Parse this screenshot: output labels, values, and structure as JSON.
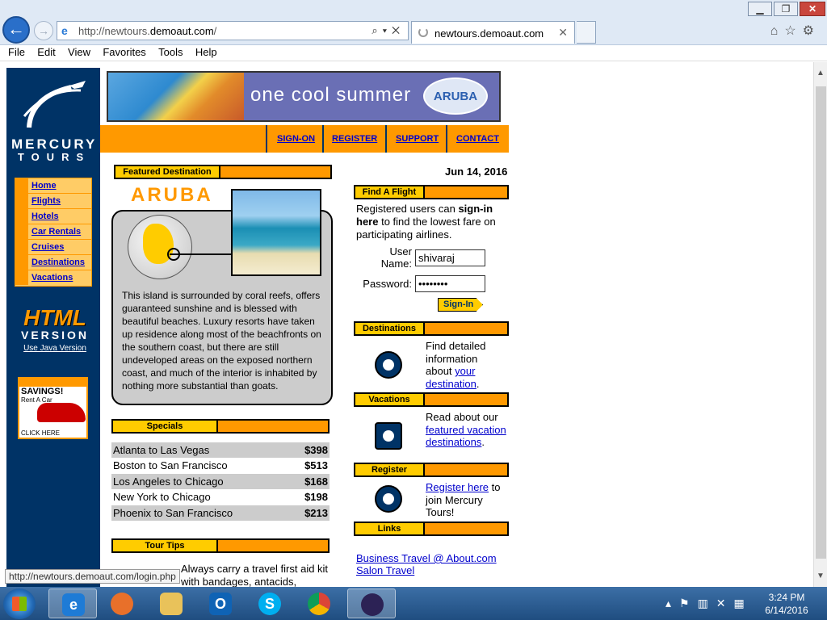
{
  "browser": {
    "url_prefix": "http://newtours.",
    "url_domain": "demoaut.com",
    "url_suffix": "/",
    "tab_title": "newtours.demoaut.com",
    "menu": [
      "File",
      "Edit",
      "View",
      "Favorites",
      "Tools",
      "Help"
    ],
    "status_url": "http://newtours.demoaut.com/login.php"
  },
  "logo": {
    "line1": "MERCURY",
    "line2": "TOURS"
  },
  "left_nav": [
    "Home",
    "Flights",
    "Hotels",
    "Car Rentals",
    "Cruises",
    "Destinations",
    "Vacations"
  ],
  "html_badge": {
    "line1": "HTML",
    "line2": "VERSION",
    "link": "Use Java Version"
  },
  "savings_ad": {
    "title": "SAVINGS!",
    "subtitle": "Rent A Car",
    "cta": "CLICK HERE"
  },
  "banner": {
    "tagline": "one cool summer",
    "logo": "ARUBA"
  },
  "top_nav": [
    "SIGN-ON",
    "REGISTER",
    "SUPPORT",
    "CONTACT"
  ],
  "featured": {
    "header": "Featured Destination",
    "title": "ARUBA",
    "description": "This island is surrounded by coral reefs, offers guaranteed sunshine and is blessed with beautiful beaches. Luxury resorts have taken up residence along most of the beachfronts on the southern coast, but there are still undeveloped areas on the exposed northern coast, and nothing more substantial than goats.",
    "description_full": "This island is surrounded by coral reefs, offers guaranteed sunshine and is blessed with beautiful beaches. Luxury resorts have taken up residence along most of the beachfronts on the southern coast, but there are still undeveloped areas on the exposed northern coast, and much of the interior is inhabited by nothing more substantial than goats."
  },
  "specials": {
    "header": "Specials",
    "rows": [
      {
        "route": "Atlanta to Las Vegas",
        "price": "$398"
      },
      {
        "route": "Boston to San Francisco",
        "price": "$513"
      },
      {
        "route": "Los Angeles to Chicago",
        "price": "$168"
      },
      {
        "route": "New York to Chicago",
        "price": "$198"
      },
      {
        "route": "Phoenix to San Francisco",
        "price": "$213"
      }
    ]
  },
  "tour_tips": {
    "header": "Tour Tips",
    "text": "Always carry a travel first aid kit with bandages, antacids,"
  },
  "date": "Jun 14, 2016",
  "find_flight": {
    "header": "Find A Flight",
    "text_pre": "Registered users can ",
    "text_bold": "sign-in here",
    "text_post": " to find the lowest fare on participating airlines.",
    "user_label": "User Name:",
    "password_label": "Password:",
    "user_value": "shivaraj",
    "password_value": "••••••••",
    "signin_button": "Sign-In"
  },
  "destinations": {
    "header": "Destinations",
    "text": "Find detailed information about ",
    "link": "your destination",
    "end": "."
  },
  "vacations": {
    "header": "Vacations",
    "text": "Read about our ",
    "link": "featured vacation destinations",
    "end": "."
  },
  "register": {
    "header": "Register",
    "link": "Register here",
    "text": " to join Mercury Tours!"
  },
  "links": {
    "header": "Links",
    "items": [
      "Business Travel @ About.com",
      "Salon Travel"
    ]
  },
  "taskbar": {
    "time": "3:24 PM",
    "date": "6/14/2016"
  },
  "colors": {
    "navy": "#003366",
    "orange": "#ff9900",
    "yellow": "#ffcc00",
    "link": "#0000cc"
  }
}
